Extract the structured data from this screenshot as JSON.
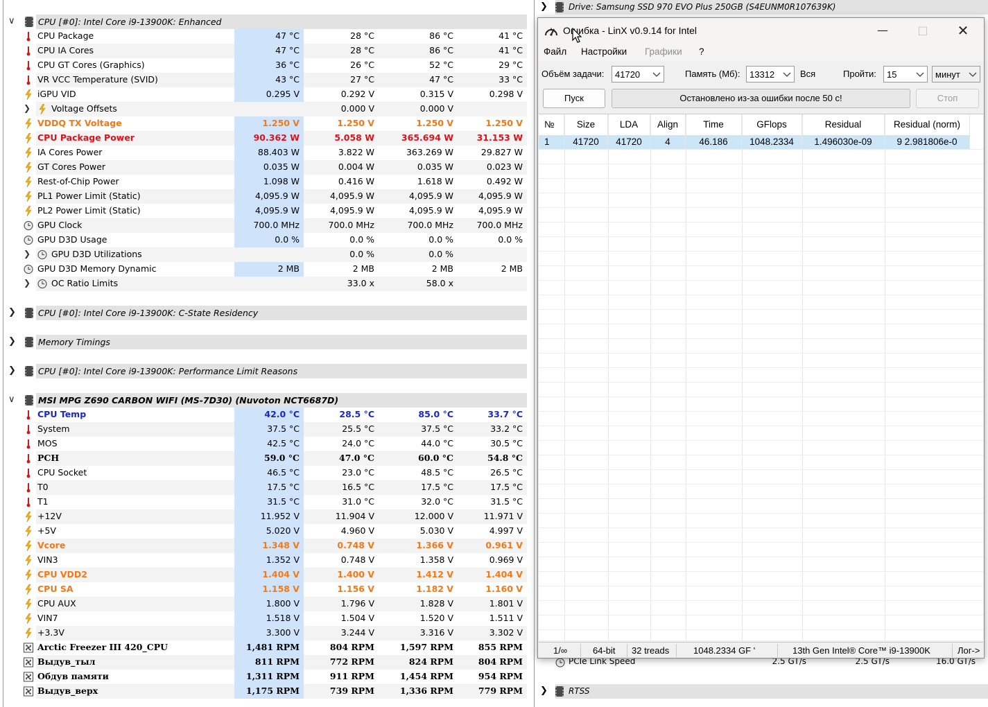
{
  "sensor_columns": [
    "Current",
    "Minimum",
    "Maximum",
    "Average"
  ],
  "cpu_group": {
    "title": "CPU [#0]: Intel Core i9-13900K: Enhanced",
    "rows": [
      {
        "name": "CPU Package",
        "icon": "thermometer-icon",
        "values": [
          "47 °C",
          "28 °C",
          "86 °C",
          "41 °C"
        ]
      },
      {
        "name": "CPU IA Cores",
        "icon": "thermometer-icon",
        "values": [
          "47 °C",
          "28 °C",
          "86 °C",
          "41 °C"
        ]
      },
      {
        "name": "CPU GT Cores (Graphics)",
        "icon": "thermometer-icon",
        "values": [
          "36 °C",
          "26 °C",
          "52 °C",
          "29 °C"
        ]
      },
      {
        "name": "VR VCC Temperature (SVID)",
        "icon": "thermometer-icon",
        "values": [
          "43 °C",
          "27 °C",
          "47 °C",
          "33 °C"
        ]
      },
      {
        "name": "iGPU VID",
        "icon": "lightning-icon",
        "values": [
          "0.295 V",
          "0.292 V",
          "0.315 V",
          "0.298 V"
        ]
      },
      {
        "name": "Voltage Offsets",
        "icon": "lightning-icon",
        "values": [
          "",
          "0.000 V",
          "0.000 V",
          ""
        ],
        "expandable": true
      },
      {
        "name": "VDDQ TX Voltage",
        "icon": "lightning-icon",
        "values": [
          "1.250 V",
          "1.250 V",
          "1.250 V",
          "1.250 V"
        ],
        "style": "orange"
      },
      {
        "name": "CPU Package Power",
        "icon": "lightning-icon",
        "values": [
          "90.362 W",
          "5.058 W",
          "365.694 W",
          "31.153 W"
        ],
        "style": "red"
      },
      {
        "name": "IA Cores Power",
        "icon": "lightning-icon",
        "values": [
          "88.403 W",
          "3.822 W",
          "363.269 W",
          "29.827 W"
        ]
      },
      {
        "name": "GT Cores Power",
        "icon": "lightning-icon",
        "values": [
          "0.035 W",
          "0.004 W",
          "0.035 W",
          "0.023 W"
        ]
      },
      {
        "name": "Rest-of-Chip Power",
        "icon": "lightning-icon",
        "values": [
          "1.098 W",
          "0.416 W",
          "1.618 W",
          "0.492 W"
        ]
      },
      {
        "name": "PL1 Power Limit (Static)",
        "icon": "lightning-icon",
        "values": [
          "4,095.9 W",
          "4,095.9 W",
          "4,095.9 W",
          "4,095.9 W"
        ]
      },
      {
        "name": "PL2 Power Limit (Static)",
        "icon": "lightning-icon",
        "values": [
          "4,095.9 W",
          "4,095.9 W",
          "4,095.9 W",
          "4,095.9 W"
        ]
      },
      {
        "name": "GPU Clock",
        "icon": "clock-icon",
        "values": [
          "700.0 MHz",
          "700.0 MHz",
          "700.0 MHz",
          "700.0 MHz"
        ]
      },
      {
        "name": "GPU D3D Usage",
        "icon": "clock-icon",
        "values": [
          "0.0 %",
          "0.0 %",
          "0.0 %",
          "0.0 %"
        ]
      },
      {
        "name": "GPU D3D Utilizations",
        "icon": "clock-icon",
        "values": [
          "",
          "0.0 %",
          "0.0 %",
          ""
        ],
        "expandable": true
      },
      {
        "name": "GPU D3D Memory Dynamic",
        "icon": "clock-icon",
        "values": [
          "2 MB",
          "2 MB",
          "2 MB",
          "2 MB"
        ]
      },
      {
        "name": "OC Ratio Limits",
        "icon": "clock-icon",
        "values": [
          "",
          "33.0 x",
          "58.0 x",
          ""
        ],
        "expandable": true
      }
    ]
  },
  "collapsed_groups": [
    "CPU [#0]: Intel Core i9-13900K: C-State Residency",
    "Memory Timings",
    "CPU [#0]: Intel Core i9-13900K: Performance Limit Reasons"
  ],
  "mb_group": {
    "title": "MSI MPG Z690 CARBON WIFI (MS-7D30) (Nuvoton NCT6687D)",
    "rows": [
      {
        "name": "CPU Temp",
        "icon": "thermometer-icon",
        "values": [
          "42.0 °C",
          "28.5 °C",
          "85.0 °C",
          "33.7 °C"
        ],
        "style": "blue"
      },
      {
        "name": "System",
        "icon": "thermometer-icon",
        "values": [
          "37.5 °C",
          "25.5 °C",
          "37.5 °C",
          "33.2 °C"
        ]
      },
      {
        "name": "MOS",
        "icon": "thermometer-icon",
        "values": [
          "42.5 °C",
          "24.0 °C",
          "44.0 °C",
          "30.5 °C"
        ]
      },
      {
        "name": "PCH",
        "icon": "thermometer-icon",
        "values": [
          "59.0 °C",
          "47.0 °C",
          "60.0 °C",
          "54.8 °C"
        ],
        "style": "bold-serif"
      },
      {
        "name": "CPU Socket",
        "icon": "thermometer-icon",
        "values": [
          "46.5 °C",
          "23.0 °C",
          "48.5 °C",
          "26.5 °C"
        ]
      },
      {
        "name": "T0",
        "icon": "thermometer-icon",
        "values": [
          "17.5 °C",
          "16.5 °C",
          "17.5 °C",
          "17.5 °C"
        ]
      },
      {
        "name": "T1",
        "icon": "thermometer-icon",
        "values": [
          "31.5 °C",
          "31.0 °C",
          "32.0 °C",
          "31.5 °C"
        ]
      },
      {
        "name": "+12V",
        "icon": "lightning-icon",
        "values": [
          "11.952 V",
          "11.904 V",
          "12.000 V",
          "11.971 V"
        ]
      },
      {
        "name": "+5V",
        "icon": "lightning-icon",
        "values": [
          "5.020 V",
          "4.960 V",
          "5.030 V",
          "4.997 V"
        ]
      },
      {
        "name": "Vcore",
        "icon": "lightning-icon",
        "values": [
          "1.348 V",
          "0.748 V",
          "1.366 V",
          "0.961 V"
        ],
        "style": "orange"
      },
      {
        "name": "VIN3",
        "icon": "lightning-icon",
        "values": [
          "1.352 V",
          "0.748 V",
          "1.358 V",
          "0.969 V"
        ]
      },
      {
        "name": "CPU VDD2",
        "icon": "lightning-icon",
        "values": [
          "1.404 V",
          "1.400 V",
          "1.412 V",
          "1.404 V"
        ],
        "style": "orange"
      },
      {
        "name": "CPU SA",
        "icon": "lightning-icon",
        "values": [
          "1.158 V",
          "1.156 V",
          "1.182 V",
          "1.160 V"
        ],
        "style": "orange"
      },
      {
        "name": "CPU AUX",
        "icon": "lightning-icon",
        "values": [
          "1.800 V",
          "1.796 V",
          "1.828 V",
          "1.801 V"
        ]
      },
      {
        "name": "VIN7",
        "icon": "lightning-icon",
        "values": [
          "1.518 V",
          "1.504 V",
          "1.520 V",
          "1.511 V"
        ]
      },
      {
        "name": "+3.3V",
        "icon": "lightning-icon",
        "values": [
          "3.300 V",
          "3.244 V",
          "3.316 V",
          "3.302 V"
        ]
      },
      {
        "name": "Arctic Freezer III 420_CPU",
        "icon": "fan-icon",
        "values": [
          "1,481 RPM",
          "804 RPM",
          "1,597 RPM",
          "855 RPM"
        ],
        "style": "bold-serif"
      },
      {
        "name": "Выдув_тыл",
        "icon": "fan-icon",
        "values": [
          "811 RPM",
          "772 RPM",
          "824 RPM",
          "804 RPM"
        ],
        "style": "bold-serif"
      },
      {
        "name": "Обдув памяти",
        "icon": "fan-icon",
        "values": [
          "1,311 RPM",
          "911 RPM",
          "1,454 RPM",
          "954 RPM"
        ],
        "style": "bold-serif"
      },
      {
        "name": "Выдув_верх",
        "icon": "fan-icon",
        "values": [
          "1,175 RPM",
          "739 RPM",
          "1,336 RPM",
          "779 RPM"
        ],
        "style": "bold-serif"
      }
    ]
  },
  "right_panel": {
    "drive_group": "Drive: Samsung SSD 970 EVO Plus 250GB (S4EUNM0R107639K)",
    "pcie_row": {
      "name": "PCIe Link Speed",
      "values": [
        "2.5 GT/s",
        "2.5 GT/s",
        "16.0 GT/s"
      ]
    },
    "rtss_group": "RTSS"
  },
  "linx": {
    "title": "Ошибка - LinX v0.9.14 for Intel",
    "menu": [
      "Файл",
      "Настройки",
      "Графики",
      "?"
    ],
    "menu_disabled": [
      false,
      false,
      true,
      false
    ],
    "problem_size_label": "Объём задачи:",
    "problem_size_value": "41720",
    "memory_label": "Память (Мб):",
    "memory_value": "13312",
    "all_label": "Вся",
    "passes_label": "Пройти:",
    "passes_value": "15",
    "units_value": "минут",
    "start_button": "Пуск",
    "status_message": "Остановлено из-за ошибки после 50 с!",
    "stop_button": "Стоп",
    "table": {
      "headers": [
        "№",
        "Size",
        "LDA",
        "Align",
        "Time",
        "GFlops",
        "Residual",
        "Residual (norm)"
      ],
      "rows": [
        [
          "1",
          "41720",
          "41720",
          "4",
          "46.186",
          "1048.2334",
          "1.496030e-09",
          "9 2.981806e-0"
        ]
      ]
    },
    "statusbar": [
      "1/∞",
      "64-bit",
      "32 treads",
      "1048.2334 GF '",
      "13th Gen Intel® Core™ i9-13900K",
      "Лог->"
    ]
  }
}
